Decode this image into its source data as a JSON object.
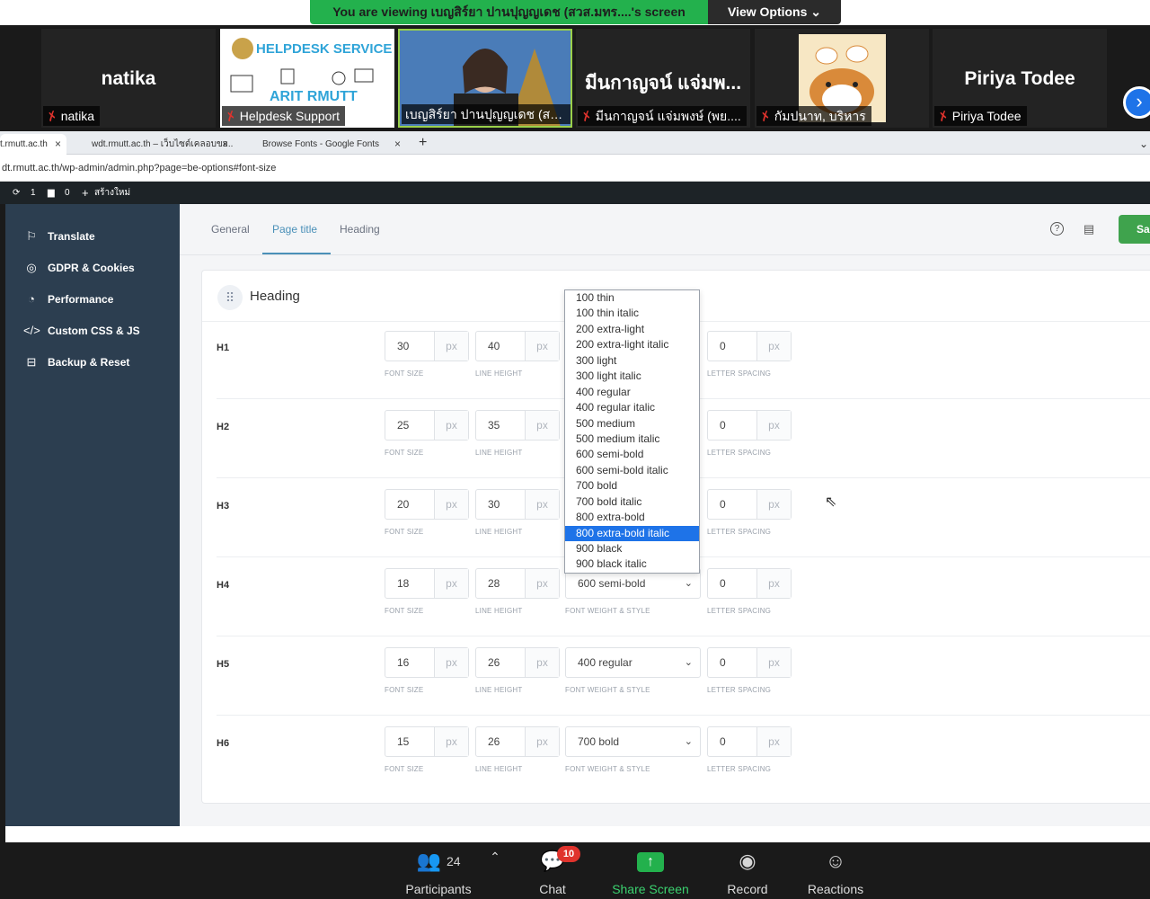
{
  "zoom": {
    "viewing_banner": "You are viewing เบญสิร์ยา ปานปุญญเดช (สวส.มทร....'s screen",
    "view_options": "View Options",
    "participants": [
      {
        "big": "natika",
        "caption": "natika"
      },
      {
        "big": "",
        "caption": "Helpdesk Support",
        "image_text": "HELPDESK SERVICE · ARIT RMUTT"
      },
      {
        "big": "",
        "caption": "เบญสิร์ยา ปานปุญญเดช (สวส...."
      },
      {
        "big": "มีนกาญจน์ แจ่มพ...",
        "caption": "มีนกาญจน์ แจ่มพงษ์ (พย...."
      },
      {
        "big": "",
        "caption": "กัมปนาท, บริหาร"
      },
      {
        "big": "Piriya Todee",
        "caption": "Piriya Todee"
      }
    ],
    "toolbar": {
      "participants_label": "Participants",
      "participants_count": "24",
      "chat_label": "Chat",
      "chat_badge": "10",
      "share_label": "Share Screen",
      "record_label": "Record",
      "reactions_label": "Reactions"
    }
  },
  "browser": {
    "tabs": [
      {
        "title": "t.rmutt.ac.th",
        "active": true
      },
      {
        "title": "wdt.rmutt.ac.th – เว็บไซต์เคลอบขอ...",
        "active": false
      },
      {
        "title": "Browse Fonts - Google Fonts",
        "active": false
      }
    ],
    "url": "dt.rmutt.ac.th/wp-admin/admin.php?page=be-options#font-size"
  },
  "wpbar": {
    "updates": "1",
    "comments": "0",
    "new_label": "สร้างใหม่"
  },
  "sidebar": {
    "items": [
      {
        "label": "Translate",
        "icon": "flag-icon"
      },
      {
        "label": "GDPR & Cookies",
        "icon": "cookie-icon"
      },
      {
        "label": "Performance",
        "icon": "gauge-icon"
      },
      {
        "label": "Custom CSS & JS",
        "icon": "code-icon"
      },
      {
        "label": "Backup & Reset",
        "icon": "drive-icon"
      }
    ]
  },
  "subnav": {
    "tabs": [
      "General",
      "Page title",
      "Heading"
    ],
    "active": "Page title",
    "save_label": "Sa"
  },
  "card": {
    "title": "Heading",
    "sublabels": {
      "font_size": "FONT SIZE",
      "line_height": "LINE HEIGHT",
      "weight": "FONT WEIGHT & STYLE",
      "letter_spacing": "LETTER SPACING"
    },
    "unit": "px",
    "rows": [
      {
        "label": "H1",
        "font_size": "30",
        "line_height": "40",
        "weight": "",
        "letter_spacing": "0"
      },
      {
        "label": "H2",
        "font_size": "25",
        "line_height": "35",
        "weight": "",
        "letter_spacing": "0"
      },
      {
        "label": "H3",
        "font_size": "20",
        "line_height": "30",
        "weight": "",
        "letter_spacing": "0"
      },
      {
        "label": "H4",
        "font_size": "18",
        "line_height": "28",
        "weight": "600 semi-bold",
        "letter_spacing": "0"
      },
      {
        "label": "H5",
        "font_size": "16",
        "line_height": "26",
        "weight": "400 regular",
        "letter_spacing": "0"
      },
      {
        "label": "H6",
        "font_size": "15",
        "line_height": "26",
        "weight": "700 bold",
        "letter_spacing": "0"
      }
    ]
  },
  "dropdown": {
    "options": [
      "100 thin",
      "100 thin italic",
      "200 extra-light",
      "200 extra-light italic",
      "300 light",
      "300 light italic",
      "400 regular",
      "400 regular italic",
      "500 medium",
      "500 medium italic",
      "600 semi-bold",
      "600 semi-bold italic",
      "700 bold",
      "700 bold italic",
      "800 extra-bold",
      "800 extra-bold italic",
      "900 black",
      "900 black italic"
    ],
    "highlighted": "800 extra-bold italic"
  }
}
